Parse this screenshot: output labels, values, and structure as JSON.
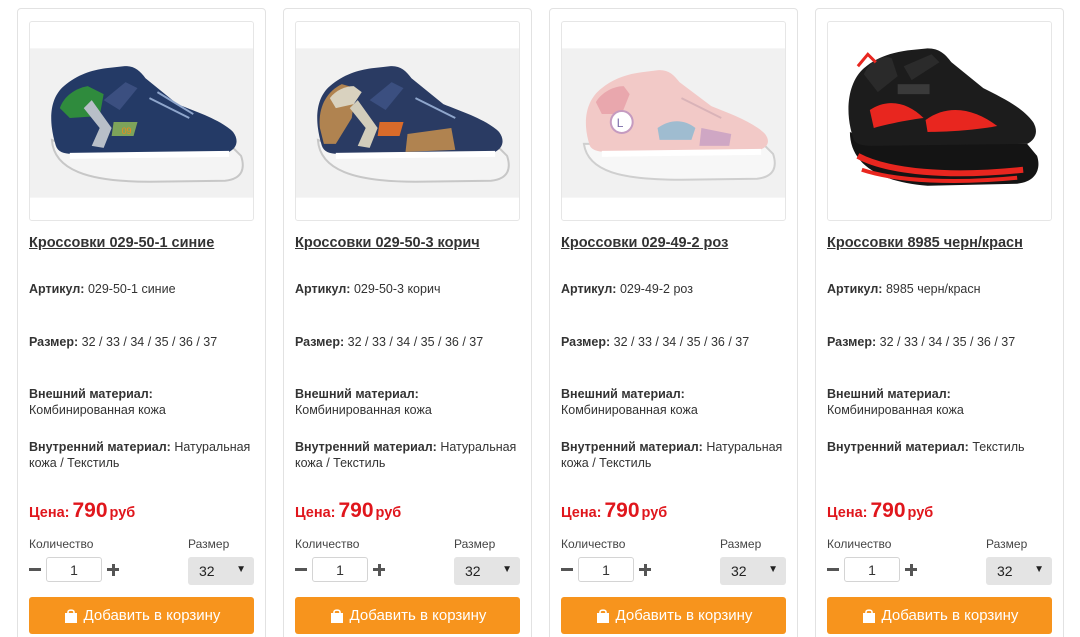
{
  "labels": {
    "article": "Артикул:",
    "size": "Размер:",
    "outer_material": "Внешний материал:",
    "inner_material": "Внутренний материал:",
    "price": "Цена:",
    "currency": "руб",
    "quantity": "Количество",
    "size_select": "Размер",
    "add_to_cart": "Добавить в корзину"
  },
  "colors": {
    "accent_button": "#f7941d",
    "price_red": "#e0161c"
  },
  "products": [
    {
      "title": "Кроссовки 029-50-1 синие",
      "article": "029-50-1 синие",
      "sizes": "32 / 33 / 34 / 35 / 36 / 37",
      "outer_material": "Комбинированная кожа",
      "inner_material": "Натуральная кожа / Текстиль",
      "price": "790",
      "quantity": "1",
      "selected_size": "32",
      "image_icon": "navy-green-sneaker"
    },
    {
      "title": "Кроссовки 029-50-3 корич",
      "article": "029-50-3 корич",
      "sizes": "32 / 33 / 34 / 35 / 36 / 37",
      "outer_material": "Комбинированная кожа",
      "inner_material": "Натуральная кожа / Текстиль",
      "price": "790",
      "quantity": "1",
      "selected_size": "32",
      "image_icon": "navy-brown-sneaker"
    },
    {
      "title": "Кроссовки 029-49-2 роз",
      "article": "029-49-2 роз",
      "sizes": "32 / 33 / 34 / 35 / 36 / 37",
      "outer_material": "Комбинированная кожа",
      "inner_material": "Натуральная кожа / Текстиль",
      "price": "790",
      "quantity": "1",
      "selected_size": "32",
      "image_icon": "pink-sneaker"
    },
    {
      "title": "Кроссовки 8985 черн/красн",
      "article": "8985 черн/красн",
      "sizes": "32 / 33 / 34 / 35 / 36 / 37",
      "outer_material": "Комбинированная кожа",
      "inner_material": "Текстиль",
      "price": "790",
      "quantity": "1",
      "selected_size": "32",
      "image_icon": "black-red-sneaker"
    }
  ]
}
